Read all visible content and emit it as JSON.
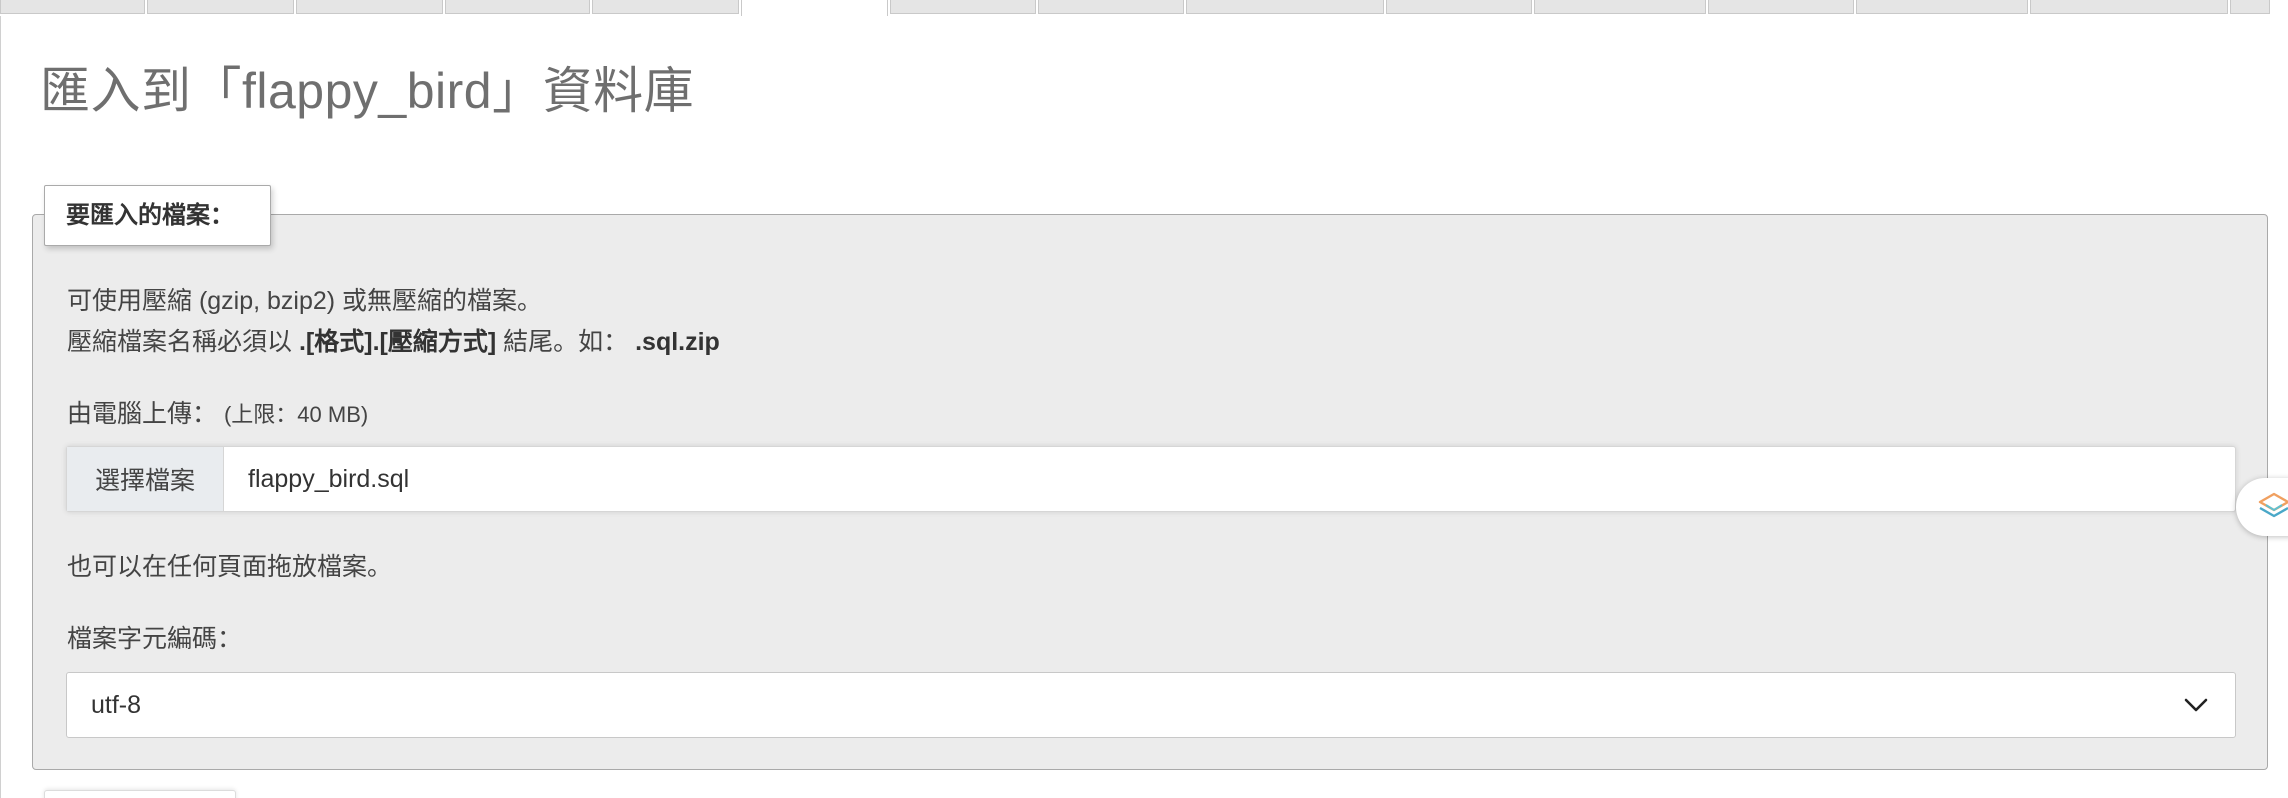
{
  "page": {
    "title": "匯入到「flappy_bird」資料庫"
  },
  "tabs": {
    "count": 15,
    "active_index": 5
  },
  "import_section": {
    "legend": "要匯入的檔案：",
    "compress_note": "可使用壓縮 (gzip, bzip2) 或無壓縮的檔案。",
    "name_rule_prefix": "壓縮檔案名稱必須以",
    "name_rule_format": ".[格式].[壓縮方式]",
    "name_rule_suffix": "結尾。如：",
    "name_rule_example": ".sql.zip",
    "upload_label": "由電腦上傳：",
    "upload_limit": "(上限：40 MB)",
    "file_button": "選擇檔案",
    "file_name": "flappy_bird.sql",
    "drag_hint": "也可以在任何頁面拖放檔案。",
    "charset_label": "檔案字元編碼：",
    "charset_value": "utf-8"
  },
  "icons": {
    "select_arrow": "chevron-down-icon",
    "side_widget": "layers-icon"
  }
}
